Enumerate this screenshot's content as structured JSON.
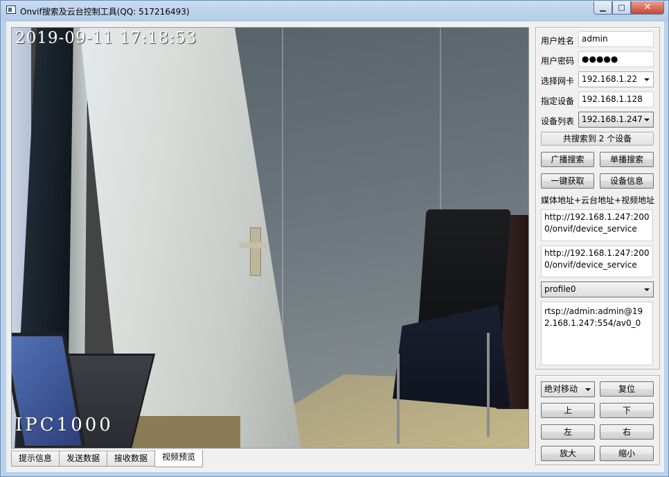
{
  "window": {
    "title": "Onvif搜索及云台控制工具(QQ: 517216493)",
    "controls": {
      "minimize": "▁",
      "maximize": "□",
      "close": "✕"
    }
  },
  "video": {
    "timestamp": "2019-09-11  17:18:53",
    "camera_name": "IPC1000"
  },
  "tabs": [
    {
      "label": "提示信息"
    },
    {
      "label": "发送数据"
    },
    {
      "label": "接收数据"
    },
    {
      "label": "视频预览",
      "active": true
    }
  ],
  "form": {
    "username_label": "用户姓名",
    "username_value": "admin",
    "password_label": "用户密码",
    "password_value": "●●●●●",
    "nic_label": "选择网卡",
    "nic_value": "192.168.1.22",
    "device_label": "指定设备",
    "device_value": "192.168.1.128",
    "device_list_label": "设备列表",
    "device_list_value": "192.168.1.247",
    "search_result": "共搜索到 2 个设备"
  },
  "buttons": {
    "broadcast_search": "广播搜索",
    "unicast_search": "单播搜索",
    "one_key_get": "一键获取",
    "device_info": "设备信息"
  },
  "addresses": {
    "caption": "媒体地址+云台地址+视频地址",
    "media_address": "http://192.168.1.247:2000/onvif/device_service",
    "ptz_address": "http://192.168.1.247:2000/onvif/device_service",
    "profile_value": "profile0",
    "rtsp_address": "rtsp://admin:admin@192.168.1.247:554/av0_0"
  },
  "ptz": {
    "move_mode": "绝对移动",
    "reset": "复位",
    "up": "上",
    "down": "下",
    "left": "左",
    "right": "右",
    "zoom_in": "放大",
    "zoom_out": "缩小"
  }
}
